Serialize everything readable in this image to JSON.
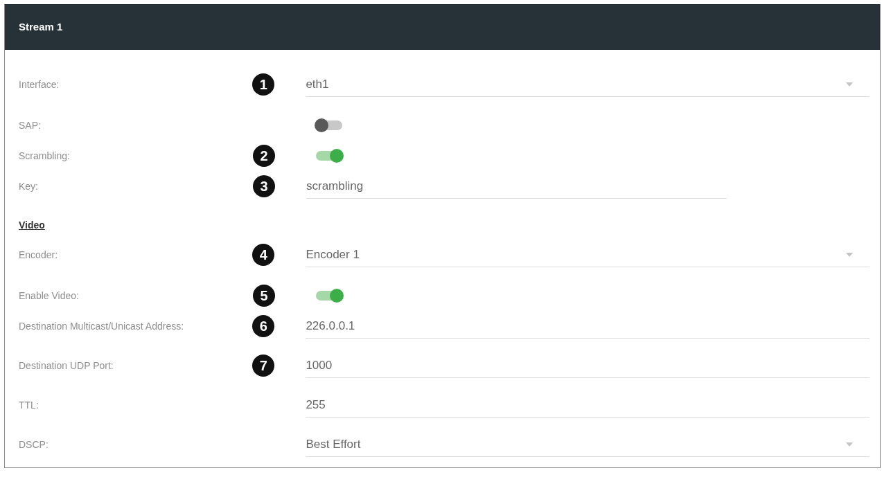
{
  "panel": {
    "title": "Stream 1"
  },
  "sections": [
    {
      "fields": [
        {
          "kind": "select",
          "label": "Interface:",
          "callout": "1",
          "value": "eth1"
        },
        {
          "kind": "toggle",
          "label": "SAP:",
          "on": false
        },
        {
          "kind": "toggle",
          "label": "Scrambling:",
          "callout": "2",
          "on": true
        },
        {
          "kind": "shorttext",
          "label": "Key:",
          "callout": "3",
          "value": "scrambling"
        }
      ]
    },
    {
      "heading": "Video",
      "fields": [
        {
          "kind": "select",
          "label": "Encoder:",
          "callout": "4",
          "value": "Encoder 1"
        },
        {
          "kind": "toggle",
          "label": "Enable Video:",
          "callout": "5",
          "on": true
        },
        {
          "kind": "text",
          "label": "Destination Multicast/Unicast Address:",
          "callout": "6",
          "value": "226.0.0.1"
        },
        {
          "kind": "text",
          "label": "Destination UDP Port:",
          "callout": "7",
          "value": "1000"
        },
        {
          "kind": "text",
          "label": "TTL:",
          "value": "255"
        },
        {
          "kind": "select",
          "label": "DSCP:",
          "value": "Best Effort"
        }
      ]
    }
  ]
}
